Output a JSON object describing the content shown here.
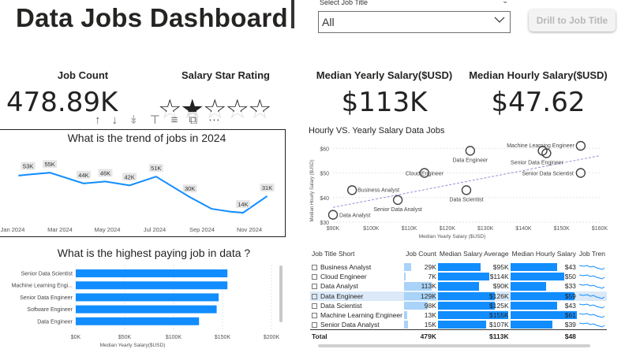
{
  "header": {
    "title": "Data Jobs Dashboard"
  },
  "slicer": {
    "label": "Select Job Title",
    "value": "All"
  },
  "drill_button": {
    "label": "Drill to Job Title"
  },
  "kpis": {
    "job_count": {
      "label": "Job Count",
      "value": "478.89K"
    },
    "rating": {
      "label": "Salary Star Rating",
      "stars_value": 2,
      "stars_max": 5
    },
    "median_yearly": {
      "label": "Median Yearly Salary($USD)",
      "value": "$113K"
    },
    "median_hourly": {
      "label": "Median Hourly Salary($USD)",
      "value": "$47.62"
    }
  },
  "colors": {
    "accent": "#118dff",
    "light_accent": "#a9d3f8",
    "selected_row": "#dbe9f8"
  },
  "line_chart": {
    "title": "What is the trend of jobs in 2024",
    "chart_data": {
      "type": "line",
      "x": [
        "Dec 2023",
        "Jan 2024",
        "Feb 2024",
        "Mar 2024",
        "Apr 2024",
        "May 2024",
        "Jun 2024",
        "Jul 2024",
        "Aug 2024",
        "Sep 2024",
        "Oct 2024",
        "Nov 2024",
        "Dec 2024"
      ],
      "values": [
        53,
        55,
        44,
        46,
        42,
        51,
        30,
        14,
        31
      ],
      "data_labels": [
        "53K",
        "55K",
        "44K",
        "46K",
        "42K",
        "51K",
        "30K",
        "14K",
        "31K"
      ],
      "label_months": [
        1.0,
        1.9,
        3.3,
        4.2,
        5.2,
        6.3,
        7.7,
        9.9,
        10.9
      ],
      "series_x": [
        0.6,
        1.0,
        1.9,
        3.3,
        4.2,
        5.2,
        6.3,
        7.7,
        8.6,
        9.4,
        9.9,
        10.9
      ],
      "series_y": [
        52,
        53,
        55,
        44,
        46,
        42,
        51,
        30,
        18,
        15,
        14,
        31
      ],
      "tick_labels": [
        "Jan 2024",
        "Mar 2024",
        "May 2024",
        "Jul 2024",
        "Sep 2024",
        "Nov 2024"
      ]
    }
  },
  "toolbar_icons": [
    "arrow-up-icon",
    "arrow-down-icon",
    "double-arrow-down-icon",
    "expand-hierarchy-icon",
    "filter-icon",
    "focus-mode-icon",
    "more-options-icon"
  ],
  "bar_chart": {
    "title": "What is the highest paying job in data ?",
    "chart_data": {
      "type": "bar",
      "categories": [
        "Senior Data Scientist",
        "Machine Learning Engi...",
        "Senior Data Engineer",
        "Software Engineer",
        "Data Engineer"
      ],
      "values": [
        155000,
        155000,
        146000,
        144000,
        126000
      ],
      "xlim": [
        0,
        200000
      ],
      "tick_labels": [
        "$0K",
        "$50K",
        "$100K",
        "$150K",
        "$200K"
      ],
      "xlabel": "Median Yearly Salary($USD)"
    }
  },
  "scatter_chart": {
    "title": "Hourly VS. Yearly Salary Data Jobs",
    "chart_data": {
      "type": "scatter",
      "xlabel": "Median Yearly Salary ($USD)",
      "ylabel": "Median Hourly Salary ($USD)",
      "xlim": [
        90000,
        160000
      ],
      "ylim": [
        30,
        62
      ],
      "x_ticks": [
        "$90K",
        "$100K",
        "$110K",
        "$120K",
        "$130K",
        "$140K",
        "$150K",
        "$160K"
      ],
      "y_ticks": [
        "$30",
        "$40",
        "$50",
        "$60"
      ],
      "points": [
        {
          "label": "Data Analyst",
          "x": 90000,
          "y": 33
        },
        {
          "label": "Business Analyst",
          "x": 95000,
          "y": 43
        },
        {
          "label": "Senior Data Analyst",
          "x": 107000,
          "y": 39
        },
        {
          "label": "Cloud Engineer",
          "x": 114000,
          "y": 50
        },
        {
          "label": "Data Scientist",
          "x": 125000,
          "y": 43
        },
        {
          "label": "Data Engineer",
          "x": 126000,
          "y": 59
        },
        {
          "label": "Senior Data Engineer",
          "x": 146000,
          "y": 58
        },
        {
          "label": "Machine Learning Engineer",
          "x": 155000,
          "y": 61
        },
        {
          "label": "Senior Data Scientist",
          "x": 155000,
          "y": 50
        }
      ],
      "extra_points": [
        {
          "x": 145000,
          "y": 59
        }
      ]
    }
  },
  "table": {
    "headers": [
      "Job Title Short",
      "Job Count",
      "Median Salary Average",
      "Median Hourly Salary",
      "Job Tren"
    ],
    "rows": [
      {
        "title": "Business Analyst",
        "count": "29K",
        "salary": "$95K",
        "hourly": "$43",
        "count_v": 29,
        "salary_v": 95,
        "hourly_v": 43
      },
      {
        "title": "Cloud Engineer",
        "count": "7K",
        "salary": "$114K",
        "hourly": "$50",
        "count_v": 7,
        "salary_v": 114,
        "hourly_v": 50
      },
      {
        "title": "Data Analyst",
        "count": "113K",
        "salary": "$90K",
        "hourly": "$33",
        "count_v": 113,
        "salary_v": 90,
        "hourly_v": 33
      },
      {
        "title": "Data Engineer",
        "count": "129K",
        "salary": "$126K",
        "hourly": "$59",
        "count_v": 129,
        "salary_v": 126,
        "hourly_v": 59,
        "selected": true
      },
      {
        "title": "Data Scientist",
        "count": "98K",
        "salary": "$125K",
        "hourly": "$43",
        "count_v": 98,
        "salary_v": 125,
        "hourly_v": 43
      },
      {
        "title": "Machine Learning Engineer",
        "count": "13K",
        "salary": "$155K",
        "hourly": "$61",
        "count_v": 13,
        "salary_v": 155,
        "hourly_v": 61
      },
      {
        "title": "Senior Data Analyst",
        "count": "15K",
        "salary": "$107K",
        "hourly": "$39",
        "count_v": 15,
        "salary_v": 107,
        "hourly_v": 39
      }
    ],
    "total": {
      "title": "Total",
      "count": "479K",
      "salary": "$113K",
      "hourly": "$48"
    }
  }
}
